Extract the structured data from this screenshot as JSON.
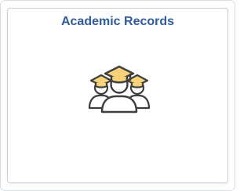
{
  "tile": {
    "title": "Academic Records",
    "icon": "graduates-icon"
  },
  "colors": {
    "title": "#2f5c9a",
    "cap_fill": "#f7d27b",
    "outline": "#3e3e3e",
    "tile_border": "#c9d1da"
  }
}
